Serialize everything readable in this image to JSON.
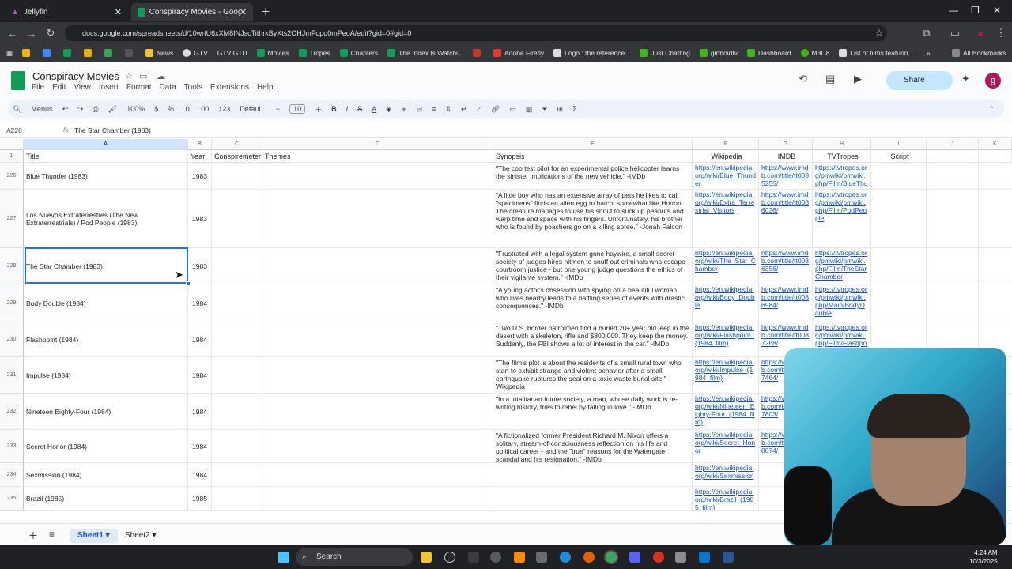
{
  "browser": {
    "tabs": [
      {
        "label": "Jellyfin",
        "active": false
      },
      {
        "label": "Conspiracy Movies - Google Sh",
        "active": true
      }
    ],
    "url": "docs.google.com/spreadsheets/d/10wrtU6xXM8INJscTithrkByXts2OHJmFopq0mPeoA/edit?gid=0#gid=0",
    "bookmarks": [
      "News",
      "GTV",
      "GTV GTD",
      "Movies",
      "Tropes",
      "Chapters",
      "The Index Is Watchi...",
      "Adobe Firefly",
      "Logo : the reference...",
      "Just Chatting",
      "globoidtv",
      "Dashboard",
      "M3U8",
      "List of films featurin..."
    ],
    "all_bookmarks": "All Bookmarks"
  },
  "doc": {
    "title": "Conspiracy Movies",
    "menu": [
      "File",
      "Edit",
      "View",
      "Insert",
      "Format",
      "Data",
      "Tools",
      "Extensions",
      "Help"
    ],
    "share_label": "Share",
    "avatar_letter": "g"
  },
  "toolbar": {
    "menus_label": "Menus",
    "zoom": "100%",
    "currency": "$",
    "percent": "%",
    "dec_dec": ".0",
    "dec_inc": ".00",
    "format_123": "123",
    "font": "Defaul...",
    "font_size": "10"
  },
  "formula": {
    "name_box": "A228",
    "fx": "fx",
    "content": "The Star Chamber (1983)"
  },
  "columns": [
    "A",
    "B",
    "C",
    "D",
    "E",
    "F",
    "G",
    "H",
    "I",
    "J",
    "K"
  ],
  "header_row": {
    "title": "Title",
    "year": "Year",
    "conspiremeter": "Conspiremeter",
    "themes": "Themes",
    "synopsis": "Synopsis",
    "wikipedia": "Wikipedia",
    "imdb": "IMDB",
    "tvtropes": "TVTropes",
    "script": "Script"
  },
  "rows": [
    {
      "num": "226",
      "title": "Blue Thunder (1983)",
      "year": "1983",
      "synopsis": "\"The cop test pilot for an experimental police helicopter learns the sinister implications of the new vehicle.\" -IMDb",
      "wiki": "https://en.wikipedia.org/wiki/Blue_Thunder",
      "imdb": "https://www.imdb.com/title/tt0085255/",
      "tvtropes": "https://tvtropes.org/pmwiki/pmwiki.php/Film/BlueThunder"
    },
    {
      "num": "227",
      "title": "Los Nuevos Extraterrestres (The New Extraterrestrials) / Pod People (1983)",
      "year": "1983",
      "synopsis": "\"A little boy who has an extensive array of pets he likes to call \"specimens\" finds an alien egg to hatch, somewhat like Horton. The creature manages to use his snout to suck up peanuts and warp time and space with his fingers. Unfortunately, his brother who is found by poachers go on a killing spree.\" -Jonah Falcon",
      "wiki": "https://en.wikipedia.org/wiki/Extra_Terrestrial_Visitors",
      "imdb": "https://www.imdb.com/title/tt0086026/",
      "tvtropes": "https://tvtropes.org/pmwiki/pmwiki.php/Film/PodPeople"
    },
    {
      "num": "228",
      "title": "The Star Chamber (1983)",
      "year": "1983",
      "synopsis": "\"Frustrated with a legal system gone haywire, a small secret society of judges hires hitmen to snuff out criminals who escape courtroom justice - but one young judge questions the ethics of their vigilante system.\" -IMDb",
      "wiki": "https://en.wikipedia.org/wiki/The_Star_Chamber",
      "imdb": "https://www.imdb.com/title/tt0086356/",
      "tvtropes": "https://tvtropes.org/pmwiki/pmwiki.php/Film/TheStarChamber"
    },
    {
      "num": "229",
      "title": "Body Double (1984)",
      "year": "1984",
      "synopsis": "\"A young actor's obsession with spying on a beautiful woman who lives nearby leads to a baffling series of events with drastic consequences.\" -IMDb",
      "wiki": "https://en.wikipedia.org/wiki/Body_Double",
      "imdb": "https://www.imdb.com/title/tt0086984/",
      "tvtropes": "https://tvtropes.org/pmwiki/pmwiki.php/Main/BodyDouble"
    },
    {
      "num": "230",
      "title": "Flashpoint (1984)",
      "year": "1984",
      "synopsis": "\"Two U.S. border patrolmen find a buried 20+ year old jeep in the desert with a skeleton, rifle and $800,000. They keep the money. Suddenly, the FBI shows a lot of interest in the car.\" -IMDb",
      "wiki": "https://en.wikipedia.org/wiki/Flashpoint_(1984_film)",
      "imdb": "https://www.imdb.com/title/tt0087268/",
      "tvtropes": "https://tvtropes.org/pmwiki/pmwiki.php/Film/Flashpoint1984"
    },
    {
      "num": "231",
      "title": "Impulse (1984)",
      "year": "1984",
      "synopsis": "\"The film's plot is about the residents of a small rural town who start to exhibit strange and violent behavior after a small earthquake ruptures the seal on a toxic waste burial site.\" -Wikipedia",
      "wiki": "https://en.wikipedia.org/wiki/Impulse_(1984_film)",
      "imdb": "https://www.imdb.com/title/tt0087464/",
      "tvtropes": ""
    },
    {
      "num": "232",
      "title": "Nineteen Eighty-Four (1984)",
      "year": "1984",
      "synopsis": "\"In a totalitarian future society, a man, whose daily work is re-writing history, tries to rebel by falling in love.\" -IMDb",
      "wiki": "https://en.wikipedia.org/wiki/Nineteen_Eighty-Four_(1984_film)",
      "imdb": "https://www.imdb.com/title/tt0087803/",
      "tvtropes": ""
    },
    {
      "num": "233",
      "title": "Secret Honor (1984)",
      "year": "1984",
      "synopsis": "\"A fictionalized former President Richard M. Nixon offers a solitary, stream-of-consciousness reflection on his life and political career - and the \"true\" reasons for the Watergate scandal and his resignation.\" -IMDb",
      "wiki": "https://en.wikipedia.org/wiki/Secret_Honor",
      "imdb": "https://www.imdb.com/title/tt0088074/",
      "tvtropes": ""
    },
    {
      "num": "234",
      "title": "Sexmission (1984)",
      "year": "1984",
      "synopsis": "",
      "wiki": "https://en.wikipedia.org/wiki/Sexmission",
      "imdb": "",
      "tvtropes": ""
    },
    {
      "num": "235",
      "title": "Brazil (1985)",
      "year": "1985",
      "synopsis": "",
      "wiki": "https://en.wikipedia.org/wiki/Brazil_(1985_film)",
      "imdb": "",
      "tvtropes": ""
    }
  ],
  "sheets": [
    "Sheet1",
    "Sheet2"
  ],
  "taskbar": {
    "search_label": "Search",
    "time": "4:24 AM",
    "date": "10/3/2025"
  }
}
